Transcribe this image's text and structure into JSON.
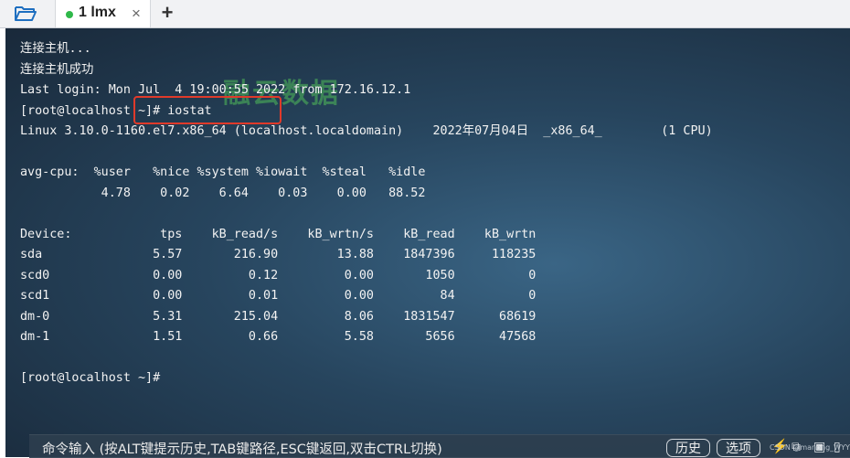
{
  "tabbar": {
    "folder_icon": "folder-open-icon",
    "tab": {
      "label": "1 lmx",
      "status_color": "#2fb84a",
      "close": "×"
    },
    "add": "+"
  },
  "watermark": "融云数据",
  "terminal": {
    "lines": [
      "连接主机...",
      "连接主机成功",
      "Last login: Mon Jul  4 19:00:55 2022 from 172.16.12.1",
      "[root@localhost ~]# iostat",
      "Linux 3.10.0-1160.el7.x86_64 (localhost.localdomain)    2022年07月04日  _x86_64_        (1 CPU)",
      "",
      "avg-cpu:  %user   %nice %system %iowait  %steal   %idle",
      "           4.78    0.02    6.64    0.03    0.00   88.52",
      "",
      "Device:            tps    kB_read/s    kB_wrtn/s    kB_read    kB_wrtn",
      "sda               5.57       216.90        13.88    1847396     118235",
      "scd0              0.00         0.12         0.00       1050          0",
      "scd1              0.00         0.01         0.00         84          0",
      "dm-0              5.31       215.04         8.06    1831547      68619",
      "dm-1              1.51         0.66         5.58       5656      47568",
      "",
      "[root@localhost ~]#"
    ],
    "highlight_color": "#e03a2a"
  },
  "cmdbar": {
    "hint": "命令输入 (按ALT键提示历史,TAB键路径,ESC键返回,双击CTRL切换)",
    "history": "历史",
    "options": "选项",
    "footnote": "CSDN @manong_WYY"
  }
}
